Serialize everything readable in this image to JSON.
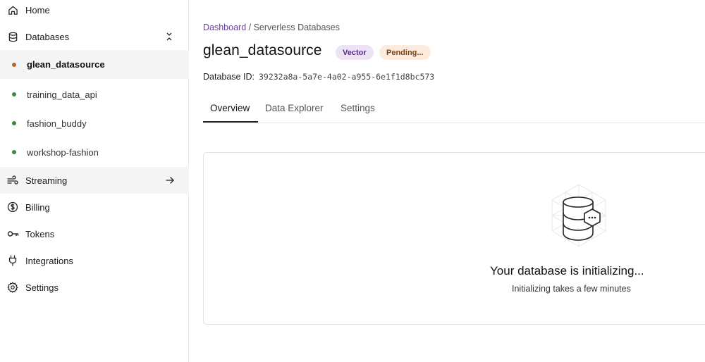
{
  "sidebar": {
    "home": "Home",
    "databases": "Databases",
    "db_items": [
      {
        "label": "glean_datasource",
        "status_color": "#b5652b"
      },
      {
        "label": "training_data_api",
        "status_color": "#3a8a3a"
      },
      {
        "label": "fashion_buddy",
        "status_color": "#3a8a3a"
      },
      {
        "label": "workshop-fashion",
        "status_color": "#3a8a3a"
      }
    ],
    "streaming": "Streaming",
    "billing": "Billing",
    "tokens": "Tokens",
    "integrations": "Integrations",
    "settings": "Settings"
  },
  "breadcrumb": {
    "root": "Dashboard",
    "separator": " / ",
    "current": "Serverless Databases"
  },
  "database": {
    "name": "glean_datasource",
    "type_badge": "Vector",
    "status_badge": "Pending...",
    "id_label": "Database ID:",
    "id_value": "39232a8a-5a7e-4a02-a955-6e1f1d8bc573"
  },
  "tabs": [
    {
      "label": "Overview",
      "active": true
    },
    {
      "label": "Data Explorer",
      "active": false
    },
    {
      "label": "Settings",
      "active": false
    }
  ],
  "status_panel": {
    "title": "Your database is initializing...",
    "subtitle": "Initializing takes a few minutes"
  },
  "colors": {
    "accent": "#6b3fa0",
    "vector_badge_bg": "#ece3f5",
    "pending_badge_bg": "#fbecdf",
    "active_status": "#3a8a3a",
    "pending_status": "#b5652b"
  }
}
